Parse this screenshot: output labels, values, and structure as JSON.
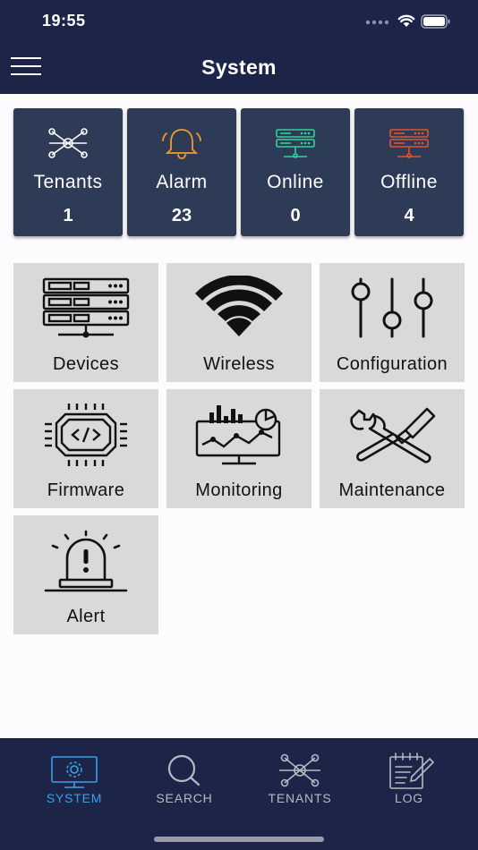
{
  "status_bar": {
    "time": "19:55"
  },
  "header": {
    "title": "System"
  },
  "stats": [
    {
      "label": "Tenants",
      "value": "1",
      "icon": "network-icon",
      "color": "#ffffff"
    },
    {
      "label": "Alarm",
      "value": "23",
      "icon": "bell-icon",
      "color": "#f39a2b"
    },
    {
      "label": "Online",
      "value": "0",
      "icon": "server-icon",
      "color": "#2fd39a"
    },
    {
      "label": "Offline",
      "value": "4",
      "icon": "server-icon",
      "color": "#e4542c"
    }
  ],
  "tiles": [
    {
      "label": "Devices",
      "icon": "devices-icon"
    },
    {
      "label": "Wireless",
      "icon": "wifi-icon"
    },
    {
      "label": "Configuration",
      "icon": "sliders-icon"
    },
    {
      "label": "Firmware",
      "icon": "chip-code-icon"
    },
    {
      "label": "Monitoring",
      "icon": "monitor-chart-icon"
    },
    {
      "label": "Maintenance",
      "icon": "tools-icon"
    },
    {
      "label": "Alert",
      "icon": "siren-icon"
    }
  ],
  "bottom_nav": [
    {
      "label": "SYSTEM",
      "icon": "monitor-gear-icon",
      "active": true
    },
    {
      "label": "SEARCH",
      "icon": "search-icon",
      "active": false
    },
    {
      "label": "TENANTS",
      "icon": "network-icon",
      "active": false
    },
    {
      "label": "LOG",
      "icon": "notepad-icon",
      "active": false
    }
  ],
  "colors": {
    "navy": "#1c2548",
    "card": "#2e3b57",
    "tile": "#d9d9d9",
    "accent": "#3aa1e8",
    "nav_inactive": "#b6b9c4"
  }
}
